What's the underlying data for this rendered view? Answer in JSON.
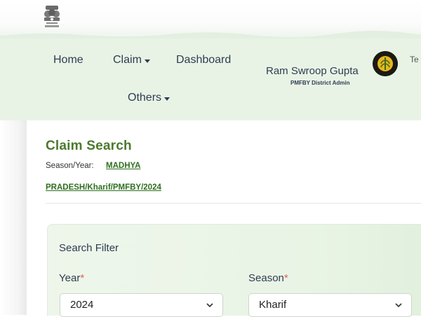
{
  "nav": {
    "items": [
      {
        "label": "Home",
        "has_dropdown": false
      },
      {
        "label": "Claim",
        "has_dropdown": true
      },
      {
        "label": "Dashboard",
        "has_dropdown": false
      },
      {
        "label": "Others",
        "has_dropdown": true
      }
    ],
    "user": {
      "name": "Ram Swroop Gupta",
      "role": "PMFBY District Admin"
    },
    "lang_partial": "Te"
  },
  "page": {
    "title": "Claim Search",
    "season_year_label": "Season/Year:",
    "season_year_link_line1": "MADHYA",
    "season_year_link_line2": "PRADESH/Kharif/PMFBY/2024"
  },
  "filter": {
    "title": "Search Filter",
    "year": {
      "label": "Year",
      "required_mark": "*",
      "value": "2024"
    },
    "season": {
      "label": "Season",
      "required_mark": "*",
      "value": "Kharif"
    }
  },
  "colors": {
    "nav_bg": "#e8f3e6",
    "title_green": "#4c7a2e",
    "link_green": "#2f6f1f",
    "required_red": "#e06060"
  }
}
